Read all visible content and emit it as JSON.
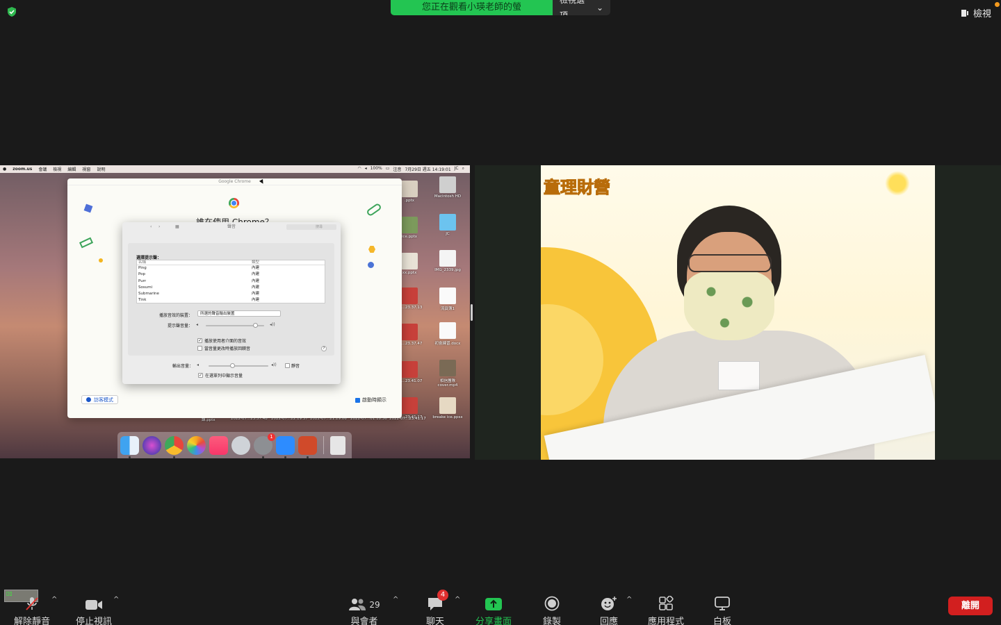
{
  "top_bar": {
    "share_banner": "您正在觀看小瑛老師的螢幕",
    "view_options_label": "檢視選項",
    "view_label": "檢視"
  },
  "shared_screen": {
    "menubar": {
      "items": [
        "zoom.us",
        "會議",
        "檢視",
        "編輯",
        "視窗",
        "說明"
      ],
      "battery": "100%",
      "lang": "注音",
      "datetime": "7月29日 週五 14:19:01",
      "user": "JC"
    },
    "chrome_window": {
      "title": "Google Chrome",
      "question": "誰在使用 Chrome？",
      "guest_button": "訪客模式",
      "show_on_startup": "啟動時顯示"
    },
    "sound_prefs": {
      "title": "聲音",
      "search_placeholder": "搜尋",
      "tabs": [
        "音效",
        "輸出",
        "輸入"
      ],
      "choose_alert": "選擇提示聲：",
      "col_name": "名稱",
      "col_type": "類型",
      "sounds": [
        {
          "name": "Ping",
          "type": "內建"
        },
        {
          "name": "Pop",
          "type": "內建"
        },
        {
          "name": "Purr",
          "type": "內建"
        },
        {
          "name": "Sosumi",
          "type": "內建"
        },
        {
          "name": "Submarine",
          "type": "內建"
        },
        {
          "name": "Tink",
          "type": "內建"
        }
      ],
      "play_through_label": "播放音效的裝置：",
      "play_through_value": "所選的聲音輸出裝置",
      "alert_volume_label": "提示聲音量：",
      "alert_volume": 0.85,
      "ui_effects_label": "播放使用者介面的音效",
      "feedback_label": "當音量更改時播放回饋音",
      "output_volume_label": "輸出音量：",
      "output_volume": 0.4,
      "mute_label": "靜音",
      "show_menubar_label": "在選單列中顯示音量"
    },
    "desktop_icons": [
      {
        "label": "Macintosh HD"
      },
      {
        "label": "JC"
      },
      {
        "label": "IMG_2339.jpg"
      },
      {
        "label": "流頁簿1"
      },
      {
        "label": "初會練習.docx"
      },
      {
        "label": "相信團隊 cover.mp4"
      },
      {
        "label": "breake ice.ppsx"
      }
    ],
    "desktop_col_labels": [
      ".pptx",
      "ice.pptx",
      "xx.pptx",
      "07...23.37.13",
      "07...23.37.47",
      "07...23.41.07",
      "07...23.41.17"
    ],
    "bottom_labels": [
      "課.pptx",
      "2022-07...23.37.48",
      "2022-07...22.19.37",
      "2022-07...21.29.06",
      "2022-07...01.18.36",
      "2022-07...23.41.17"
    ],
    "dock_badge": "1"
  },
  "video": {
    "background_title": "童理財營"
  },
  "toolbar": {
    "unmute": "解除靜音",
    "stop_video": "停止視訊",
    "participants": "與會者",
    "participants_count": "29",
    "chat": "聊天",
    "chat_badge": "4",
    "share": "分享畫面",
    "record": "錄製",
    "reactions": "回應",
    "apps": "應用程式",
    "whiteboard": "白板",
    "leave": "離開"
  },
  "colors": {
    "share_green": "#23c552",
    "leave_red": "#d21f1f",
    "chat_badge_red": "#e02f2f"
  }
}
